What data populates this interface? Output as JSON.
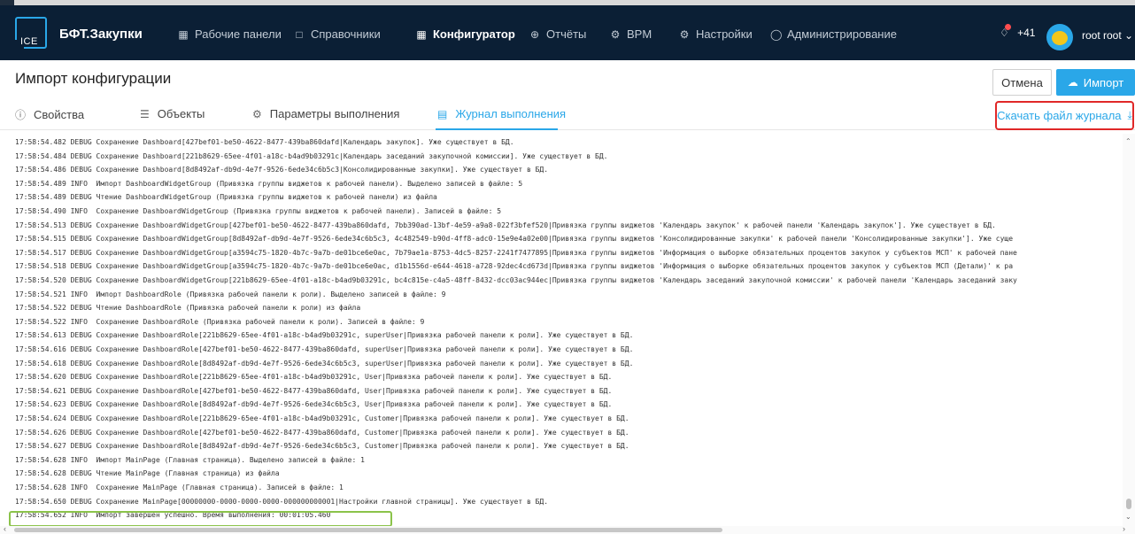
{
  "app": {
    "logo_text": "ICE",
    "brand": "БФТ.Закупки"
  },
  "nav": {
    "items": [
      {
        "label": "Рабочие панели",
        "icon": "dashboard-icon"
      },
      {
        "label": "Справочники",
        "icon": "book-icon"
      },
      {
        "label": "Конфигуратор",
        "icon": "grid-icon",
        "active": true
      },
      {
        "label": "Отчёты",
        "icon": "report-icon"
      },
      {
        "label": "BPM",
        "icon": "bpm-icon"
      },
      {
        "label": "Настройки",
        "icon": "gear-icon"
      },
      {
        "label": "Администрирование",
        "icon": "shield-icon"
      }
    ],
    "notifications": "+41",
    "user": "root root"
  },
  "page": {
    "title": "Импорт конфигурации",
    "cancel_label": "Отмена",
    "import_label": "Импорт"
  },
  "tabs": [
    {
      "label": "Свойства",
      "icon": "info-icon"
    },
    {
      "label": "Объекты",
      "icon": "list-icon"
    },
    {
      "label": "Параметры выполнения",
      "icon": "settings-icon"
    },
    {
      "label": "Журнал выполнения",
      "icon": "journal-icon",
      "active": true
    }
  ],
  "download_label": "Скачать файл журнала",
  "colors": {
    "navbar": "#0b1f35",
    "accent": "#2aa7e8",
    "red_box": "#e02828",
    "green_box": "#8bc34a"
  },
  "log": [
    "17:58:54.482 DEBUG Сохранение Dashboard[427bef01-be50-4622-8477-439ba860dafd|Календарь закупок]. Уже существует в БД.",
    "17:58:54.484 DEBUG Сохранение Dashboard[221b8629-65ee-4f01-a18c-b4ad9b03291c|Календарь заседаний закупочной комиссии]. Уже существует в БД.",
    "17:58:54.486 DEBUG Сохранение Dashboard[8d8492af-db9d-4e7f-9526-6ede34c6b5c3|Консолидированные закупки]. Уже существует в БД.",
    "17:58:54.489 INFO  Импорт DashboardWidgetGroup (Привязка группы виджетов к рабочей панели). Выделено записей в файле: 5",
    "17:58:54.489 DEBUG Чтение DashboardWidgetGroup (Привязка группы виджетов к рабочей панели) из файла",
    "17:58:54.490 INFO  Сохранение DashboardWidgetGroup (Привязка группы виджетов к рабочей панели). Записей в файле: 5",
    "17:58:54.513 DEBUG Сохранение DashboardWidgetGroup[427bef01-be50-4622-8477-439ba860dafd, 7bb390ad-13bf-4e59-a9a8-022f3bfef520|Привязка группы виджетов 'Календарь закупок' к рабочей панели 'Календарь закупок']. Уже существует в БД.",
    "17:58:54.515 DEBUG Сохранение DashboardWidgetGroup[8d8492af-db9d-4e7f-9526-6ede34c6b5c3, 4c482549-b90d-4ff8-adc0-15e9e4a02e00|Привязка группы виджетов 'Консолидированные закупки' к рабочей панели 'Консолидированные закупки']. Уже суще",
    "17:58:54.517 DEBUG Сохранение DashboardWidgetGroup[a3594c75-1820-4b7c-9a7b-de01bce6e0ac, 7b79ae1a-8753-4dc5-8257-2241f7477895|Привязка группы виджетов 'Информация о выборке обязательных процентов закупок у субъектов МСП' к рабочей пане",
    "17:58:54.518 DEBUG Сохранение DashboardWidgetGroup[a3594c75-1820-4b7c-9a7b-de01bce6e0ac, d1b1556d-e644-4618-a728-92dec4cd673d|Привязка группы виджетов 'Информация о выборке обязательных процентов закупок у субъектов МСП (Детали)' к ра",
    "17:58:54.520 DEBUG Сохранение DashboardWidgetGroup[221b8629-65ee-4f01-a18c-b4ad9b03291c, bc4c815e-c4a5-48ff-8432-dcc03ac944ec|Привязка группы виджетов 'Календарь заседаний закупочной комиссии' к рабочей панели 'Календарь заседаний заку",
    "17:58:54.521 INFO  Импорт DashboardRole (Привязка рабочей панели к роли). Выделено записей в файле: 9",
    "17:58:54.522 DEBUG Чтение DashboardRole (Привязка рабочей панели к роли) из файла",
    "17:58:54.522 INFO  Сохранение DashboardRole (Привязка рабочей панели к роли). Записей в файле: 9",
    "17:58:54.613 DEBUG Сохранение DashboardRole[221b8629-65ee-4f01-a18c-b4ad9b03291c, superUser|Привязка рабочей панели к роли]. Уже существует в БД.",
    "17:58:54.616 DEBUG Сохранение DashboardRole[427bef01-be50-4622-8477-439ba860dafd, superUser|Привязка рабочей панели к роли]. Уже существует в БД.",
    "17:58:54.618 DEBUG Сохранение DashboardRole[8d8492af-db9d-4e7f-9526-6ede34c6b5c3, superUser|Привязка рабочей панели к роли]. Уже существует в БД.",
    "17:58:54.620 DEBUG Сохранение DashboardRole[221b8629-65ee-4f01-a18c-b4ad9b03291c, User|Привязка рабочей панели к роли]. Уже существует в БД.",
    "17:58:54.621 DEBUG Сохранение DashboardRole[427bef01-be50-4622-8477-439ba860dafd, User|Привязка рабочей панели к роли]. Уже существует в БД.",
    "17:58:54.623 DEBUG Сохранение DashboardRole[8d8492af-db9d-4e7f-9526-6ede34c6b5c3, User|Привязка рабочей панели к роли]. Уже существует в БД.",
    "17:58:54.624 DEBUG Сохранение DashboardRole[221b8629-65ee-4f01-a18c-b4ad9b03291c, Customer|Привязка рабочей панели к роли]. Уже существует в БД.",
    "17:58:54.626 DEBUG Сохранение DashboardRole[427bef01-be50-4622-8477-439ba860dafd, Customer|Привязка рабочей панели к роли]. Уже существует в БД.",
    "17:58:54.627 DEBUG Сохранение DashboardRole[8d8492af-db9d-4e7f-9526-6ede34c6b5c3, Customer|Привязка рабочей панели к роли]. Уже существует в БД.",
    "17:58:54.628 INFO  Импорт MainPage (Главная страница). Выделено записей в файле: 1",
    "17:58:54.628 DEBUG Чтение MainPage (Главная страница) из файла",
    "17:58:54.628 INFO  Сохранение MainPage (Главная страница). Записей в файле: 1",
    "17:58:54.650 DEBUG Сохранение MainPage[00000000-0000-0000-0000-000000000001|Настройки главной страницы]. Уже существует в БД.",
    "17:58:54.652 INFO  Импорт завершён успешно. Время выполнения: 00:01:05.460"
  ]
}
